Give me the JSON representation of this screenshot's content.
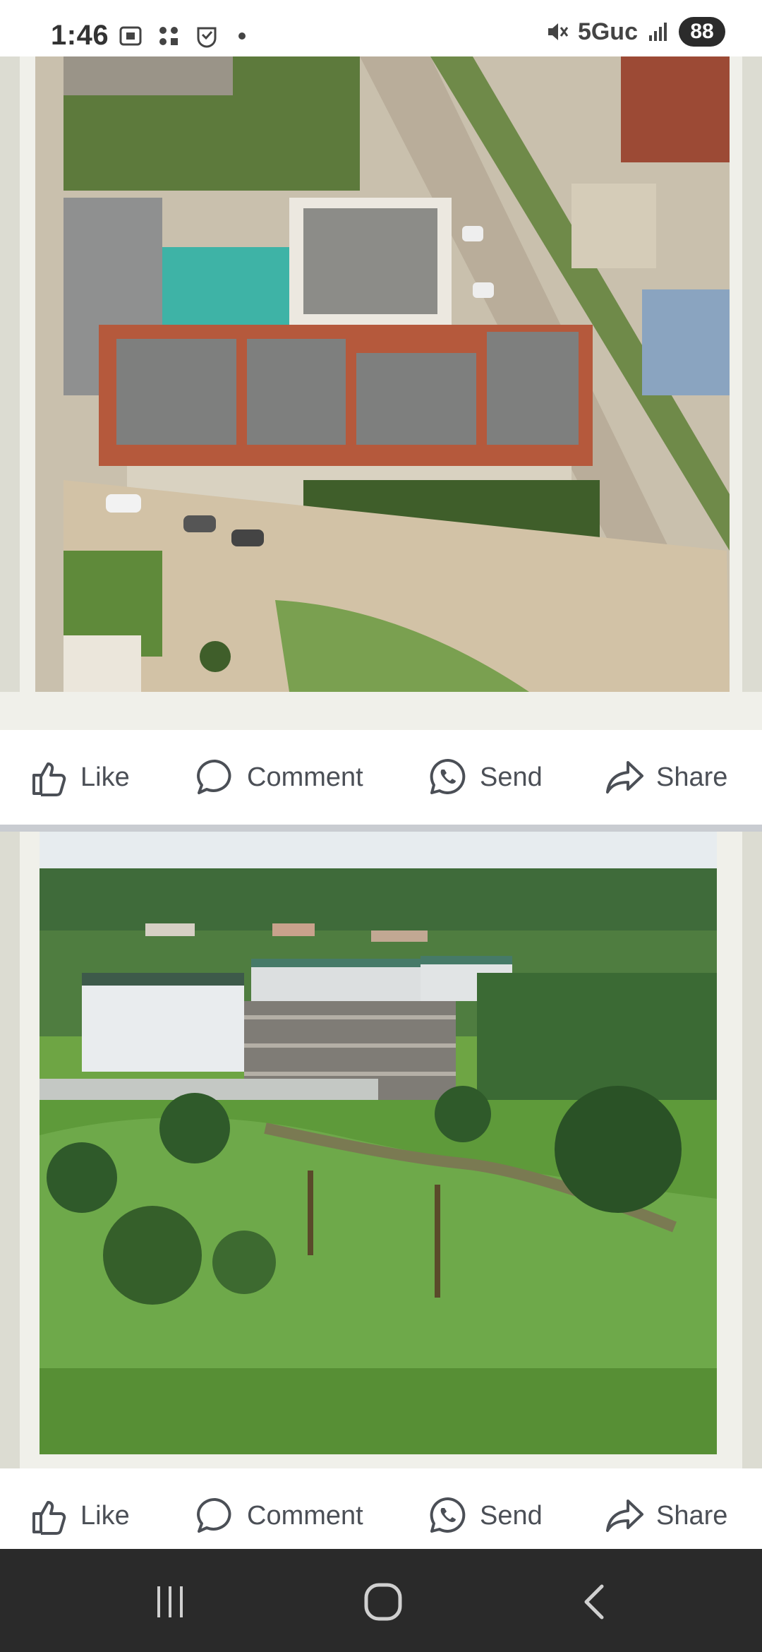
{
  "status_bar": {
    "time": "1:46",
    "network": "5Guc",
    "battery": "88"
  },
  "posts": [
    {
      "image_alt": "Aerial view of a modern apartment complex with pools beside a road",
      "actions": {
        "like": "Like",
        "comment": "Comment",
        "send": "Send",
        "share": "Share"
      }
    },
    {
      "image_alt": "Aerial view of multistory buildings among palm trees and green field",
      "actions": {
        "like": "Like",
        "comment": "Comment",
        "send": "Send",
        "share": "Share"
      }
    }
  ],
  "colors": {
    "frame": "#f0f0ea",
    "nav_bar": "#2a2a2a",
    "action_text": "#4b4f56"
  }
}
